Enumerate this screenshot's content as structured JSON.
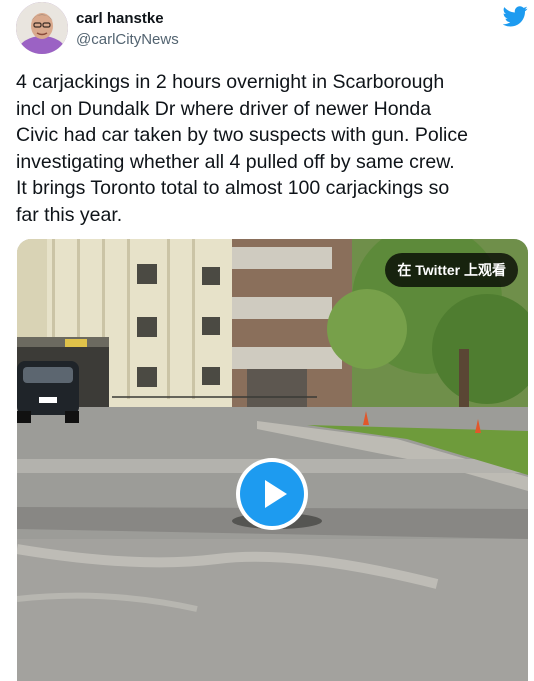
{
  "author": {
    "display_name": "carl hanstke",
    "handle": "@carlCityNews"
  },
  "tweet": {
    "text": "4 carjackings in 2 hours overnight in Scarborough\nincl on Dundalk Dr where driver of newer Honda\nCivic had car taken by two suspects with gun.  Police\ninvestigating whether all 4 pulled off by same crew.\nIt brings Toronto total to almost 100 carjackings so\nfar this year."
  },
  "media": {
    "badge_label": "在 Twitter 上观看",
    "type": "video"
  },
  "icons": {
    "brand": "twitter-bird-icon",
    "play": "play-icon"
  },
  "colors": {
    "accent": "#1d9bf0",
    "text": "#0f1419",
    "secondary": "#536471"
  }
}
